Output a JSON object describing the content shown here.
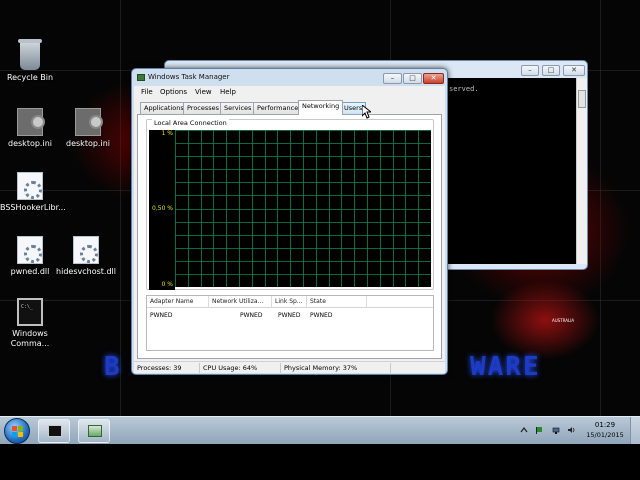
{
  "desktop": {
    "wallpaper_logo_left": "B",
    "wallpaper_logo_right": "WARE",
    "wallpaper_map_label": "AUSTRALIA",
    "icons": [
      {
        "label": "Recycle Bin",
        "icon": "recycle-bin-icon"
      },
      {
        "label": "desktop.ini",
        "icon": "ini-file-icon"
      },
      {
        "label": "desktop.ini",
        "icon": "ini-file-icon"
      },
      {
        "label": "BSSHookerLibr...",
        "icon": "dll-file-icon"
      },
      {
        "label": "pwned.dll",
        "icon": "dll-file-icon"
      },
      {
        "label": "hidesvchost.dll",
        "icon": "dll-file-icon"
      },
      {
        "label": "Windows Comma...",
        "icon": "command-prompt-icon"
      }
    ]
  },
  "cmd_window": {
    "visible_text": "served.",
    "controls": {
      "minimize": "–",
      "maximize": "□",
      "close": "✕"
    }
  },
  "task_manager": {
    "title": "Windows Task Manager",
    "controls": {
      "minimize": "–",
      "maximize": "□",
      "close": "✕"
    },
    "menu": [
      "File",
      "Options",
      "View",
      "Help"
    ],
    "tabs": [
      "Applications",
      "Processes",
      "Services",
      "Performance",
      "Networking",
      "Users"
    ],
    "active_tab": "Networking",
    "hover_tab": "Users",
    "networking": {
      "group_label": "Local Area Connection",
      "y_axis": {
        "top": "1 %",
        "middle": "0,50 %",
        "bottom": "0 %"
      },
      "graph": {
        "type": "line",
        "ylim": [
          0,
          1
        ],
        "values": [],
        "grid": true,
        "colors": {
          "background": "#000000",
          "grid": "#0d8a57",
          "axis_text": "#e4e400"
        }
      },
      "columns": [
        "Adapter Name",
        "Network Utiliza...",
        "Link Sp...",
        "State"
      ],
      "rows": [
        {
          "adapter_name": "PWNED",
          "network_utilization": "PWNED",
          "link_speed": "PWNED",
          "state": "PWNED"
        }
      ]
    },
    "status": {
      "processes": "Processes: 39",
      "cpu": "CPU Usage: 64%",
      "memory": "Physical Memory: 37%"
    }
  },
  "taskbar": {
    "pinned": [
      "command-prompt-taskbar-icon",
      "task-manager-taskbar-icon"
    ],
    "tray_icons": [
      "show-hidden-icons-icon",
      "action-center-flag-icon",
      "network-icon",
      "volume-icon"
    ],
    "clock_time": "01:29",
    "clock_date": "15/01/2015"
  },
  "colors": {
    "accent": "#1c3cc8",
    "graph_grid": "#0d8a57",
    "close_button": "#d44b3c"
  }
}
